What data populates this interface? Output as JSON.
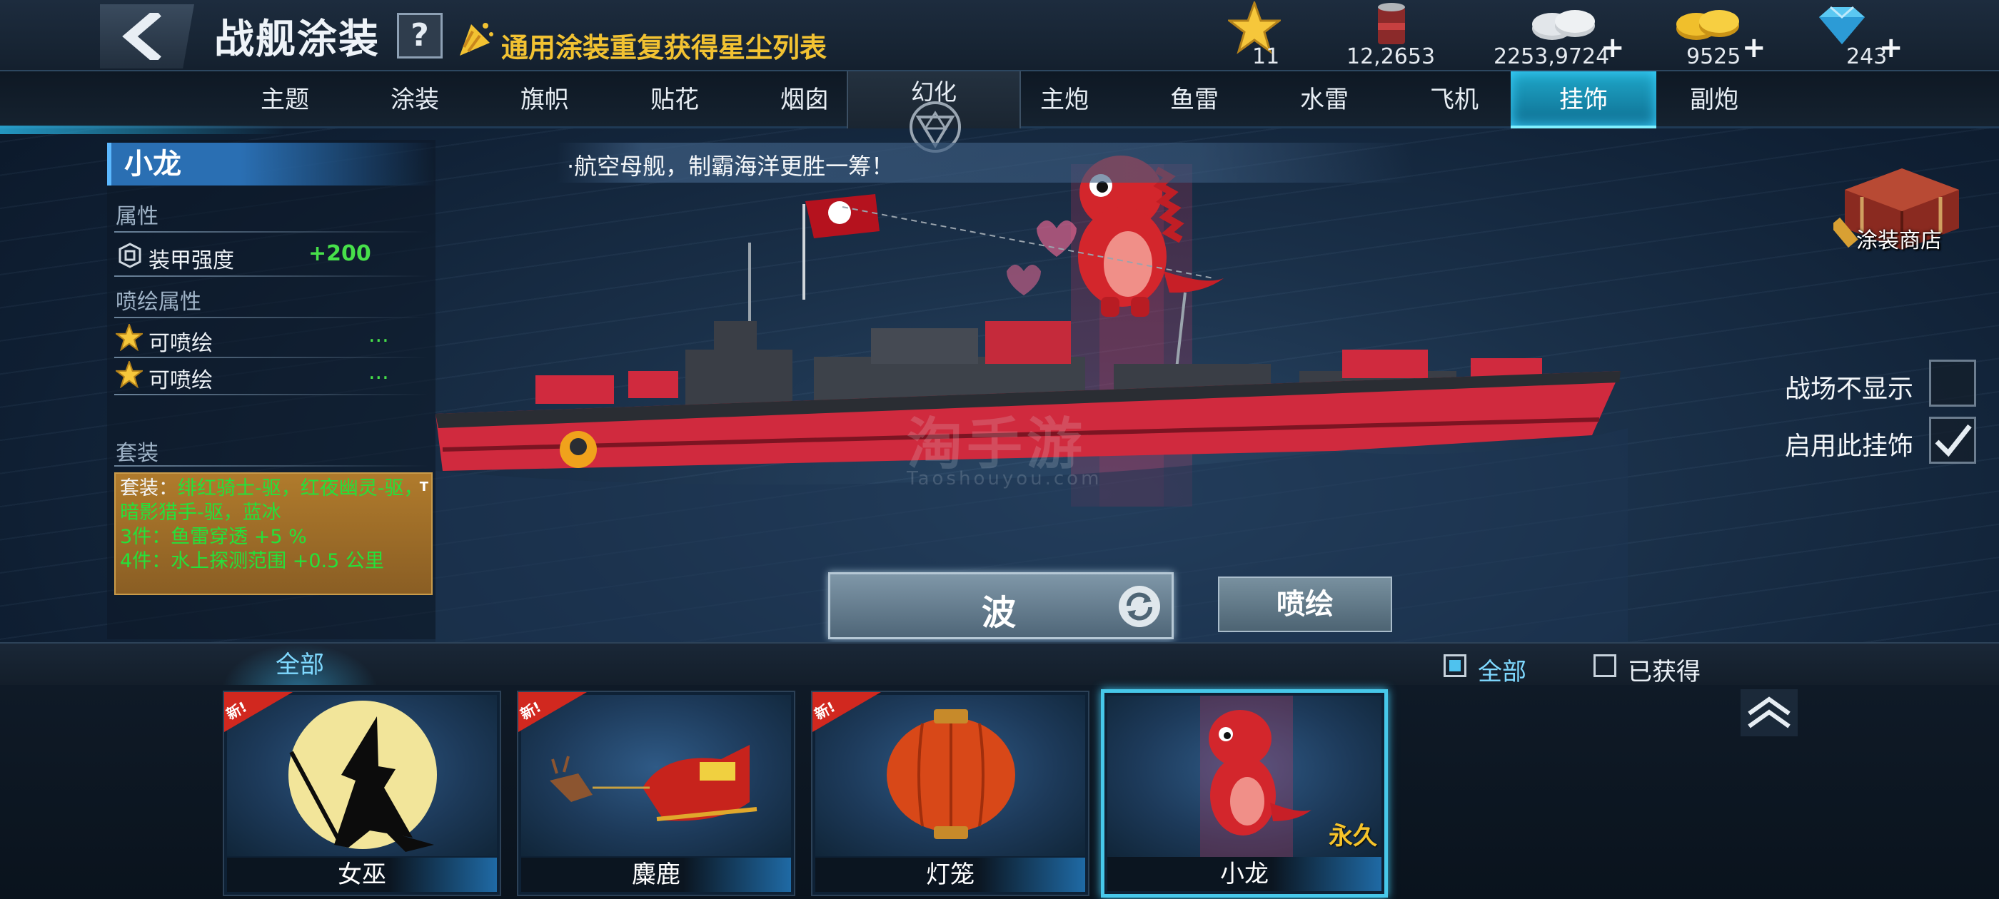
{
  "header": {
    "title": "战舰涂装",
    "help_label": "?",
    "notice": "通用涂装重复获得星尘列表",
    "resources": [
      {
        "icon": "star-icon",
        "value": "11",
        "plus": ""
      },
      {
        "icon": "paint-bucket-icon",
        "value": "12,2653",
        "plus": ""
      },
      {
        "icon": "silver-coin-icon",
        "value": "2253,9724",
        "plus": "+"
      },
      {
        "icon": "gold-coin-icon",
        "value": "9525",
        "plus": "+"
      },
      {
        "icon": "diamond-icon",
        "value": "243",
        "plus": "+"
      }
    ]
  },
  "tabs": {
    "left": [
      "主题",
      "涂装",
      "旗帜",
      "贴花",
      "烟囱"
    ],
    "center": "幻化",
    "right": [
      "主炮",
      "鱼雷",
      "水雷",
      "飞机",
      "挂饰",
      "副炮"
    ],
    "active": "挂饰"
  },
  "info": {
    "name": "小龙",
    "attr_title": "属性",
    "attrs": [
      {
        "label": "装甲强度",
        "value": "+200"
      }
    ],
    "paint_title": "喷绘属性",
    "paint_attrs": [
      {
        "label": "可喷绘",
        "value": "..."
      },
      {
        "label": "可喷绘",
        "value": "..."
      }
    ],
    "set_title": "套装",
    "set_lines": [
      {
        "label": "套装：",
        "text": "绯红骑士-驱，红夜幽灵-驱，暗影猎手-驱，蓝冰"
      },
      {
        "label": "",
        "text": "3件：鱼雷穿透 +5 %"
      },
      {
        "label": "",
        "text": "4件：水上探测范围 +0.5 公里"
      }
    ],
    "set_corner": "T"
  },
  "slogan": "·航空母舰，制霸海洋更胜一筹！",
  "watermark": {
    "main": "淘手游",
    "sub": "Taoshouyou.com"
  },
  "shop_label": "涂装商店",
  "toggles": [
    {
      "label": "战场不显示",
      "checked": false
    },
    {
      "label": "启用此挂饰",
      "checked": true
    }
  ],
  "actions": {
    "wave": "波",
    "paint": "喷绘"
  },
  "filter": {
    "category": "全部",
    "options": [
      {
        "label": "全部",
        "checked": true
      },
      {
        "label": "已获得",
        "checked": false
      }
    ]
  },
  "items": [
    {
      "name": "女巫",
      "badge": "新!",
      "tag": "",
      "icon": "witch-icon"
    },
    {
      "name": "麋鹿",
      "badge": "新!",
      "tag": "",
      "icon": "reindeer-sleigh-icon"
    },
    {
      "name": "灯笼",
      "badge": "新!",
      "tag": "",
      "icon": "lantern-icon"
    },
    {
      "name": "小龙",
      "badge": "",
      "tag": "永久",
      "icon": "dragon-icon"
    }
  ],
  "colors": {
    "accent": "#1fa7c9",
    "gold": "#f2c232",
    "green": "#47e04a",
    "ship_red": "#d02a3e"
  }
}
